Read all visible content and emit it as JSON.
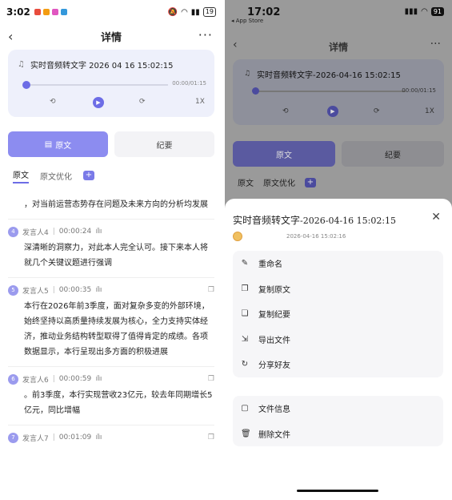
{
  "left": {
    "status": {
      "time": "3:02",
      "battery": "19"
    },
    "nav": {
      "title": "详情",
      "back": "‹",
      "more": "···"
    },
    "audio": {
      "title": "实时音频转文字 2026 04 16 15:02:15",
      "duration": "00:00/01:15",
      "rewind": "⟲",
      "forward": "⟳",
      "speed": "1X"
    },
    "tabs": {
      "original": "原文",
      "minutes": "纪要"
    },
    "subtabs": {
      "original": "原文",
      "optimized": "原文优化",
      "add": "+"
    },
    "segments": [
      {
        "text": "，对当前运营态势存在问题及未来方向的分析均发展"
      },
      {
        "num": "4",
        "speaker": "发言人4",
        "time": "00:00:24",
        "text": "深清晰的洞察力，对此本人完全认可。接下来本人将就几个关键议题进行强调"
      },
      {
        "num": "5",
        "speaker": "发言人5",
        "time": "00:00:35",
        "text": "本行在2026年前3季度，面对复杂多变的外部环境，始终坚持以高质量持续发展为核心，全力支持实体经济，推动业务结构转型取得了值得肯定的成绩。各项数据显示，本行呈现出多方面的积极进展"
      },
      {
        "num": "6",
        "speaker": "发言人6",
        "time": "00:00:59",
        "text": "。前3季度，本行实现营收23亿元，较去年同期增长5亿元，同比增幅"
      },
      {
        "num": "7",
        "speaker": "发言人7",
        "time": "00:01:09"
      }
    ]
  },
  "right": {
    "status": {
      "time": "17:02",
      "store": "◂ App Store",
      "battery": "91"
    },
    "nav": {
      "title": "详情"
    },
    "audio": {
      "title": "实时音频转文字-2026-04-16 15:02:15",
      "duration": "00:00/01:15",
      "speed": "1X"
    },
    "tabs": {
      "original": "原文",
      "minutes": "纪要"
    },
    "subtabs": {
      "original": "原文",
      "optimized": "原文优化",
      "add": "+"
    },
    "sheet": {
      "title_main": "实时音频转文字",
      "title_date": "-2026-04-16 15:02:15",
      "date": "2026-04-16 15:02:16",
      "close": "✕",
      "group1": [
        {
          "icon": "edit-icon",
          "glyph": "✎",
          "label": "重命名"
        },
        {
          "icon": "copy-icon",
          "glyph": "❐",
          "label": "复制原文"
        },
        {
          "icon": "copy-minutes-icon",
          "glyph": "❏",
          "label": "复制纪要"
        },
        {
          "icon": "export-icon",
          "glyph": "⇲",
          "label": "导出文件"
        },
        {
          "icon": "share-icon",
          "glyph": "↻",
          "label": "分享好友"
        }
      ],
      "group2": [
        {
          "icon": "file-info-icon",
          "glyph": "▢",
          "label": "文件信息"
        },
        {
          "icon": "delete-icon",
          "glyph": "🗑",
          "label": "删除文件"
        }
      ]
    }
  }
}
